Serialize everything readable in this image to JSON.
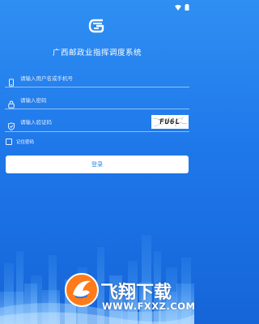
{
  "app": {
    "title": "广西邮政业指挥调度系统"
  },
  "login_form": {
    "username_placeholder": "请输入用户名或手机号",
    "password_placeholder": "请输入密码",
    "captcha_placeholder": "请输入验证码",
    "captcha_text": "FU6L",
    "remember_label": "记住密码",
    "login_label": "登录"
  },
  "watermark": {
    "title": "飞翔下载",
    "url": "WWW.FXXZ.COM"
  },
  "icons": [
    "wifi-icon",
    "battery-icon",
    "logo-icon",
    "phone-icon",
    "lock-icon",
    "shield-icon",
    "checkbox-icon"
  ],
  "colors": {
    "background": "#1f78ea",
    "button_text": "#2a86ea"
  }
}
